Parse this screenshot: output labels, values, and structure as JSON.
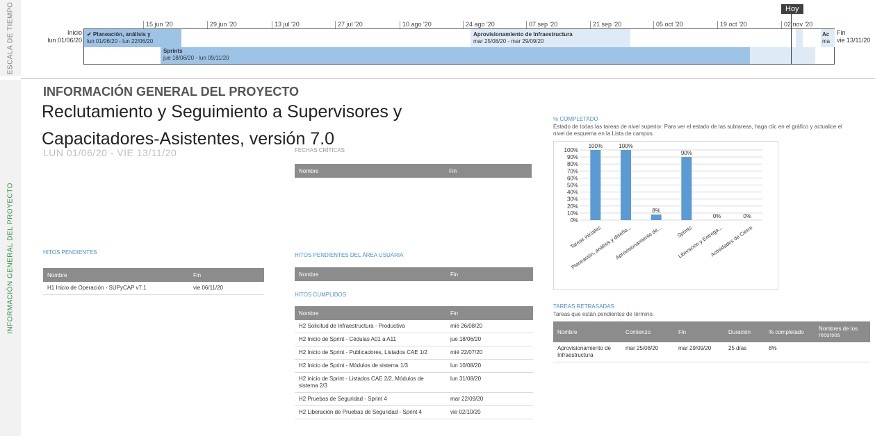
{
  "side_tabs": {
    "timeline_label": "ESCALA DE TIEMPO",
    "info_label": "INFORMACIÓN GENERAL DEL PROYECTO"
  },
  "timeline": {
    "ticks": [
      "15 jun '20",
      "29 jun '20",
      "13 jul '20",
      "27 jul '20",
      "10 ago '20",
      "24 ago '20",
      "07 sep '20",
      "21 sep '20",
      "05 oct '20",
      "19 oct '20",
      "02 nov '20"
    ],
    "start_label": "Inicio",
    "start_date": "lun 01/06/20",
    "end_label": "Fin",
    "end_date": "vie 13/11/20",
    "today_label": "Hoy",
    "tasks": [
      {
        "name": "✔ Planeación, análisis y",
        "dates": "lun 01/06/20 - lun 22/06/20"
      },
      {
        "name": "Aprovisionamiento de Infraestructura",
        "dates": "mar 25/08/20 - mar 29/09/20"
      },
      {
        "name": "Ac",
        "dates": "ma"
      },
      {
        "name": "Sprints",
        "dates": "jue 18/06/20 - lun 09/11/20"
      }
    ]
  },
  "header": {
    "section": "INFORMACIÓN GENERAL DEL PROYECTO",
    "title": "Reclutamiento y Seguimiento a Supervisores y Capacitadores-Asistentes, versión 7.0",
    "dates": "LUN 01/06/20 -  VIE 13/11/20"
  },
  "fechas_criticas": {
    "title": "FECHAS CRÍTICAS",
    "columns": [
      "Nombre",
      "Fin"
    ]
  },
  "hitos_pendientes": {
    "title": "HITOS PENDIENTES",
    "columns": [
      "Nombre",
      "Fin"
    ],
    "rows": [
      [
        "H1 Inicio de Operación - SUPyCAP v7.1",
        "vie 06/11/20"
      ]
    ]
  },
  "hitos_usuaria": {
    "title": "HITOS PENDIENTES DEL ÁREA USUARIA",
    "columns": [
      "Nombre",
      "Fin"
    ]
  },
  "hitos_cumplidos": {
    "title": "HITOS CUMPLIDOS",
    "columns": [
      "Nombre",
      "Fin"
    ],
    "rows": [
      [
        "H2 Solicitud de Infraestructura - Productiva",
        "mié 26/08/20"
      ],
      [
        "H2 Inicio de Sprint - Cédulas A01 a A11",
        "jue 18/06/20"
      ],
      [
        "H2 Inicio de Sprint - Publicadores, Listados CAE 1/2",
        "mié 22/07/20"
      ],
      [
        "H2 Inicio de Sprint - Módulos de sistema 1/3",
        "lun 10/08/20"
      ],
      [
        "H2 inicio de Sprint - Listados CAE 2/2, Módulos de sistema 2/3",
        "lun 31/08/20"
      ],
      [
        "H2 Pruebas de Seguridad - Sprint 4",
        "mar 22/09/20"
      ],
      [
        "H2 Liberación de Pruebas de Seguridad - Sprint 4",
        "vie 02/10/20"
      ]
    ]
  },
  "completado": {
    "title": "% COMPLETADO",
    "description": "Estado de todas las tareas de nivel superior. Para ver el estado de las subtareas, haga clic en el gráfico y actualice el nivel de esquema en la Lista de campos."
  },
  "chart_data": {
    "type": "bar",
    "categories": [
      "Tareas iniciales",
      "Planeación, análisis y diseño...",
      "Aprovisionamiento de...",
      "Sprints",
      "Liberación y Entrega...",
      "Actividades de Cierre"
    ],
    "values": [
      100,
      100,
      8,
      90,
      0,
      0
    ],
    "data_labels": [
      "100%",
      "100%",
      "8%",
      "90%",
      "0%",
      "0%"
    ],
    "ylim": [
      0,
      100
    ],
    "yticks": [
      "0%",
      "10%",
      "20%",
      "30%",
      "40%",
      "50%",
      "60%",
      "70%",
      "80%",
      "90%",
      "100%"
    ],
    "grid": true,
    "bar_color": "#5b9bd5"
  },
  "tareas_retrasadas": {
    "title": "TAREAS RETRASADAS",
    "description": "Tareas que están pendientes de término.",
    "columns": [
      "Nombre",
      "Comienzo",
      "Fin",
      "Duración",
      "% completado",
      "Nombres de los recursos"
    ],
    "rows": [
      [
        "Aprovisionamiento de Infraestructura",
        "mar 25/08/20",
        "mar 29/09/20",
        "25 días",
        "8%",
        ""
      ]
    ]
  }
}
